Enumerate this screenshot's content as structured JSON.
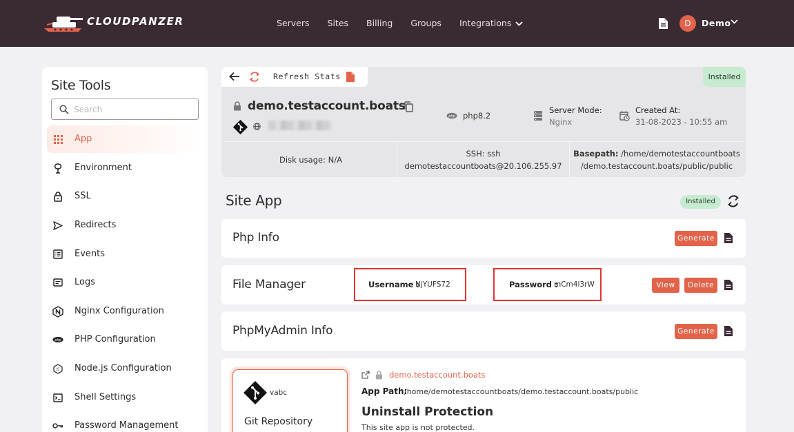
{
  "brand": {
    "name": "CLOUDPANZER"
  },
  "nav": [
    {
      "label": "Servers"
    },
    {
      "label": "Sites"
    },
    {
      "label": "Billing"
    },
    {
      "label": "Groups"
    },
    {
      "label": "Integrations"
    }
  ],
  "user": {
    "initial": "D",
    "name": "Demo"
  },
  "sidebar": {
    "title": "Site Tools",
    "search_placeholder": "Search",
    "items": [
      {
        "label": "App",
        "icon": "grid-icon",
        "active": true
      },
      {
        "label": "Environment",
        "icon": "environment-icon"
      },
      {
        "label": "SSL",
        "icon": "lock-icon"
      },
      {
        "label": "Redirects",
        "icon": "send-icon"
      },
      {
        "label": "Events",
        "icon": "list-icon"
      },
      {
        "label": "Logs",
        "icon": "logs-icon"
      },
      {
        "label": "Nginx Configuration",
        "icon": "nginx-icon"
      },
      {
        "label": "PHP Configuration",
        "icon": "php-icon"
      },
      {
        "label": "Node.js Configuration",
        "icon": "nodejs-icon"
      },
      {
        "label": "Shell Settings",
        "icon": "terminal-icon"
      },
      {
        "label": "Password Management",
        "icon": "key-icon"
      }
    ]
  },
  "site": {
    "refresh_label": "Refresh Stats",
    "status": "Installed",
    "domain": "demo.testaccount.boats",
    "php": "php8.2",
    "server_mode_label": "Server Mode:",
    "server_mode_value": "Nginx",
    "created_label": "Created At:",
    "created_value": "31-08-2023 - 10:55 am",
    "disk_usage": "Disk usage: N/A",
    "ssh_line1": "SSH: ssh",
    "ssh_line2": "demotestaccountboats@20.106.255.97",
    "basepath_label": "Basepath:",
    "basepath_line1": " /home/demotestaccountboats",
    "basepath_line2": "/demo.testaccount.boats/public/public"
  },
  "site_app": {
    "title": "Site App",
    "status": "Installed",
    "php_info": {
      "title": "Php Info",
      "generate": "Generate"
    },
    "file_manager": {
      "title": "File Manager",
      "username_label": "Username :",
      "username_value": "NjYUFS72",
      "password_label": "Password :",
      "password_value": "mCm4l3rW",
      "view": "View",
      "delete": "Delete"
    },
    "phpmyadmin": {
      "title": "PhpMyAdmin Info",
      "generate": "Generate"
    },
    "git": {
      "name": "vabc",
      "label": "Git Repository"
    },
    "app_domain": "demo.testaccount.boats",
    "app_path_label": "App Path:",
    "app_path_value": "/home/demotestaccountboats/demo.testaccount.boats/public",
    "uninstall_title": "Uninstall Protection",
    "uninstall_sub": "This site app is not protected."
  },
  "colors": {
    "header_bg": "#3a2a34",
    "accent": "#e2634a",
    "installed_bg": "#c6ebd0",
    "highlight_border": "#e03333"
  }
}
